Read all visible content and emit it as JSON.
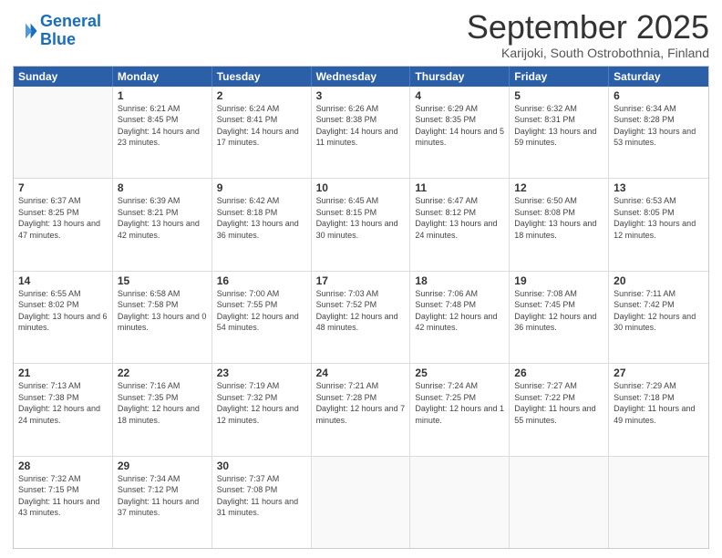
{
  "header": {
    "logo_line1": "General",
    "logo_line2": "Blue",
    "month": "September 2025",
    "location": "Karijoki, South Ostrobothnia, Finland"
  },
  "weekdays": [
    "Sunday",
    "Monday",
    "Tuesday",
    "Wednesday",
    "Thursday",
    "Friday",
    "Saturday"
  ],
  "weeks": [
    [
      {
        "day": "",
        "sunrise": "",
        "sunset": "",
        "daylight": ""
      },
      {
        "day": "1",
        "sunrise": "Sunrise: 6:21 AM",
        "sunset": "Sunset: 8:45 PM",
        "daylight": "Daylight: 14 hours and 23 minutes."
      },
      {
        "day": "2",
        "sunrise": "Sunrise: 6:24 AM",
        "sunset": "Sunset: 8:41 PM",
        "daylight": "Daylight: 14 hours and 17 minutes."
      },
      {
        "day": "3",
        "sunrise": "Sunrise: 6:26 AM",
        "sunset": "Sunset: 8:38 PM",
        "daylight": "Daylight: 14 hours and 11 minutes."
      },
      {
        "day": "4",
        "sunrise": "Sunrise: 6:29 AM",
        "sunset": "Sunset: 8:35 PM",
        "daylight": "Daylight: 14 hours and 5 minutes."
      },
      {
        "day": "5",
        "sunrise": "Sunrise: 6:32 AM",
        "sunset": "Sunset: 8:31 PM",
        "daylight": "Daylight: 13 hours and 59 minutes."
      },
      {
        "day": "6",
        "sunrise": "Sunrise: 6:34 AM",
        "sunset": "Sunset: 8:28 PM",
        "daylight": "Daylight: 13 hours and 53 minutes."
      }
    ],
    [
      {
        "day": "7",
        "sunrise": "Sunrise: 6:37 AM",
        "sunset": "Sunset: 8:25 PM",
        "daylight": "Daylight: 13 hours and 47 minutes."
      },
      {
        "day": "8",
        "sunrise": "Sunrise: 6:39 AM",
        "sunset": "Sunset: 8:21 PM",
        "daylight": "Daylight: 13 hours and 42 minutes."
      },
      {
        "day": "9",
        "sunrise": "Sunrise: 6:42 AM",
        "sunset": "Sunset: 8:18 PM",
        "daylight": "Daylight: 13 hours and 36 minutes."
      },
      {
        "day": "10",
        "sunrise": "Sunrise: 6:45 AM",
        "sunset": "Sunset: 8:15 PM",
        "daylight": "Daylight: 13 hours and 30 minutes."
      },
      {
        "day": "11",
        "sunrise": "Sunrise: 6:47 AM",
        "sunset": "Sunset: 8:12 PM",
        "daylight": "Daylight: 13 hours and 24 minutes."
      },
      {
        "day": "12",
        "sunrise": "Sunrise: 6:50 AM",
        "sunset": "Sunset: 8:08 PM",
        "daylight": "Daylight: 13 hours and 18 minutes."
      },
      {
        "day": "13",
        "sunrise": "Sunrise: 6:53 AM",
        "sunset": "Sunset: 8:05 PM",
        "daylight": "Daylight: 13 hours and 12 minutes."
      }
    ],
    [
      {
        "day": "14",
        "sunrise": "Sunrise: 6:55 AM",
        "sunset": "Sunset: 8:02 PM",
        "daylight": "Daylight: 13 hours and 6 minutes."
      },
      {
        "day": "15",
        "sunrise": "Sunrise: 6:58 AM",
        "sunset": "Sunset: 7:58 PM",
        "daylight": "Daylight: 13 hours and 0 minutes."
      },
      {
        "day": "16",
        "sunrise": "Sunrise: 7:00 AM",
        "sunset": "Sunset: 7:55 PM",
        "daylight": "Daylight: 12 hours and 54 minutes."
      },
      {
        "day": "17",
        "sunrise": "Sunrise: 7:03 AM",
        "sunset": "Sunset: 7:52 PM",
        "daylight": "Daylight: 12 hours and 48 minutes."
      },
      {
        "day": "18",
        "sunrise": "Sunrise: 7:06 AM",
        "sunset": "Sunset: 7:48 PM",
        "daylight": "Daylight: 12 hours and 42 minutes."
      },
      {
        "day": "19",
        "sunrise": "Sunrise: 7:08 AM",
        "sunset": "Sunset: 7:45 PM",
        "daylight": "Daylight: 12 hours and 36 minutes."
      },
      {
        "day": "20",
        "sunrise": "Sunrise: 7:11 AM",
        "sunset": "Sunset: 7:42 PM",
        "daylight": "Daylight: 12 hours and 30 minutes."
      }
    ],
    [
      {
        "day": "21",
        "sunrise": "Sunrise: 7:13 AM",
        "sunset": "Sunset: 7:38 PM",
        "daylight": "Daylight: 12 hours and 24 minutes."
      },
      {
        "day": "22",
        "sunrise": "Sunrise: 7:16 AM",
        "sunset": "Sunset: 7:35 PM",
        "daylight": "Daylight: 12 hours and 18 minutes."
      },
      {
        "day": "23",
        "sunrise": "Sunrise: 7:19 AM",
        "sunset": "Sunset: 7:32 PM",
        "daylight": "Daylight: 12 hours and 12 minutes."
      },
      {
        "day": "24",
        "sunrise": "Sunrise: 7:21 AM",
        "sunset": "Sunset: 7:28 PM",
        "daylight": "Daylight: 12 hours and 7 minutes."
      },
      {
        "day": "25",
        "sunrise": "Sunrise: 7:24 AM",
        "sunset": "Sunset: 7:25 PM",
        "daylight": "Daylight: 12 hours and 1 minute."
      },
      {
        "day": "26",
        "sunrise": "Sunrise: 7:27 AM",
        "sunset": "Sunset: 7:22 PM",
        "daylight": "Daylight: 11 hours and 55 minutes."
      },
      {
        "day": "27",
        "sunrise": "Sunrise: 7:29 AM",
        "sunset": "Sunset: 7:18 PM",
        "daylight": "Daylight: 11 hours and 49 minutes."
      }
    ],
    [
      {
        "day": "28",
        "sunrise": "Sunrise: 7:32 AM",
        "sunset": "Sunset: 7:15 PM",
        "daylight": "Daylight: 11 hours and 43 minutes."
      },
      {
        "day": "29",
        "sunrise": "Sunrise: 7:34 AM",
        "sunset": "Sunset: 7:12 PM",
        "daylight": "Daylight: 11 hours and 37 minutes."
      },
      {
        "day": "30",
        "sunrise": "Sunrise: 7:37 AM",
        "sunset": "Sunset: 7:08 PM",
        "daylight": "Daylight: 11 hours and 31 minutes."
      },
      {
        "day": "",
        "sunrise": "",
        "sunset": "",
        "daylight": ""
      },
      {
        "day": "",
        "sunrise": "",
        "sunset": "",
        "daylight": ""
      },
      {
        "day": "",
        "sunrise": "",
        "sunset": "",
        "daylight": ""
      },
      {
        "day": "",
        "sunrise": "",
        "sunset": "",
        "daylight": ""
      }
    ]
  ]
}
